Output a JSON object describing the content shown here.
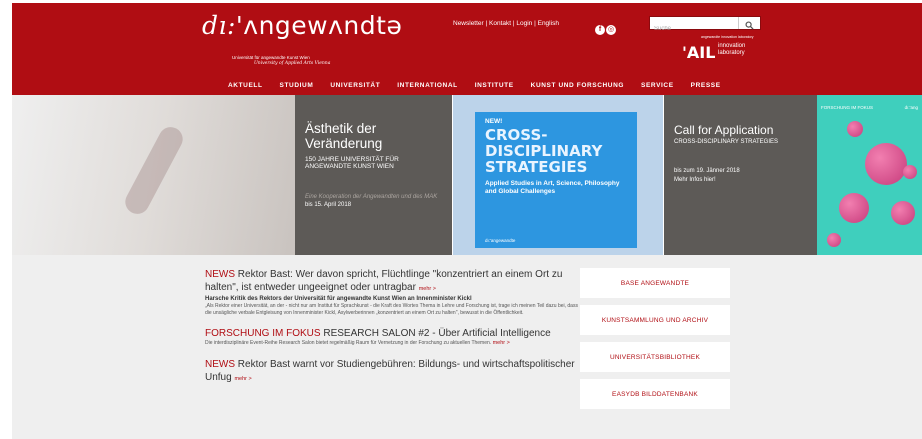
{
  "header": {
    "logo_di": "dı:",
    "logo_name": "'ʌngewʌndtə",
    "subtitle_de": "Universität für angewandte Kunst Wien",
    "subtitle_en": "University of Applied Arts Vienna",
    "links": {
      "newsletter": "Newsletter",
      "kontakt": "Kontakt",
      "login": "Login",
      "english": "English",
      "sep": " | "
    },
    "social": [
      {
        "icon": "facebook-icon",
        "glyph": "f"
      },
      {
        "icon": "instagram-icon",
        "glyph": "◎"
      }
    ],
    "search": {
      "placeholder": "Suche",
      "icon": "search-icon"
    },
    "ail": {
      "small": "angewandte innovation laboratory",
      "logo": "'AIL",
      "line1": "innovation",
      "line2": "laboratory"
    }
  },
  "nav": [
    "AKTUELL",
    "STUDIUM",
    "UNIVERSITÄT",
    "INTERNATIONAL",
    "INSTITUTE",
    "KUNST UND FORSCHUNG",
    "SERVICE",
    "PRESSE"
  ],
  "hero": {
    "slide1": {
      "title": "Ästhetik der Veränderung",
      "subtitle": "150 JAHRE UNIVERSITÄT FÜR ANGEWANDTE KUNST WIEN",
      "kooperation": "Eine Kooperation der Angewandten und des MAK",
      "date": "bis 15. April 2018"
    },
    "slide2": {
      "new": "NEW!",
      "title": "CROSS-DISCIPLINARY STRATEGIES",
      "desc": "Applied Studies in Art, Science, Philosophy and Global Challenges",
      "logo": "dı:'angewandte"
    },
    "slide3": {
      "title": "Call for Application",
      "subtitle": "CROSS-DISCIPLINARY STRATEGIES",
      "date": "bis zum 19. Jänner 2018",
      "more": "Mehr Infos hier!"
    },
    "slide4": {
      "label": "FORSCHUNG IM FOKUS",
      "logo": "dı:'ang"
    }
  },
  "news": [
    {
      "category": "NEWS",
      "title": "Rektor Bast: Wer davon spricht, Flüchtlinge \"konzentriert an einem Ort zu halten\", ist entweder ungeeignet oder untragbar",
      "more": "mehr >",
      "lead": "Harsche Kritik des Rektors der Universität für angewandte Kunst Wien an Innenminister Kickl",
      "body": "„Als Rektor einer Universität, an der - nicht nur am Institut für Sprachkunst - die Kraft des Wortes Thema in Lehre und Forschung ist, trage ich meinen Teil dazu bei, dass die unsägliche verbale Entgleisung von Innenminister Kickl, Asylwerberinnen „konzentriert an einem Ort zu halten\", bewusst in die Öffentlichkeit."
    },
    {
      "category": "FORSCHUNG IM FOKUS",
      "title": "RESEARCH SALON #2 - Über Artificial Intelligence",
      "more": "mehr >",
      "lead": "",
      "body": "Die interdisziplinäre Event-Reihe Research Salon bietet regelmäßig Raum für Vernetzung in der Forschung zu aktuellen Themen."
    },
    {
      "category": "NEWS",
      "title": "Rektor Bast warnt vor Studiengebühren: Bildungs- und wirtschaftspolitischer Unfug",
      "more": "mehr >",
      "lead": "",
      "body": ""
    }
  ],
  "quicklinks": [
    "BASE ANGEWANDTE",
    "KUNSTSAMMLUNG UND ARCHIV",
    "UNIVERSITÄTSBIBLIOTHEK",
    "EASYDB BILDDATENBANK"
  ],
  "colors": {
    "brand_red": "#b00d13",
    "slide_grey": "#5d5a57",
    "poster_blue": "#2d96e0",
    "teal": "#3fcfbd",
    "news_bg": "#efefef"
  }
}
